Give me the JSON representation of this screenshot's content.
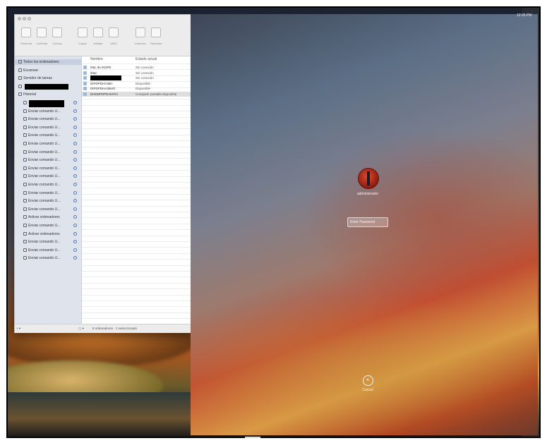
{
  "menubar": {
    "clock": "12:05 PM"
  },
  "window": {
    "toolbar": [
      {
        "label": "Observar",
        "icon": "observe-icon"
      },
      {
        "label": "Controlar",
        "icon": "control-icon"
      },
      {
        "label": "Curioso",
        "icon": "curtain-icon"
      },
      {
        "label": "Copiar",
        "icon": "copy-icon"
      },
      {
        "label": "Instalar",
        "icon": "install-icon"
      },
      {
        "label": "UNIX",
        "icon": "unix-icon"
      },
      {
        "label": "Informes",
        "icon": "reports-icon"
      },
      {
        "label": "Reinician",
        "icon": "restart-icon"
      }
    ],
    "sidebar": [
      {
        "label": "Todos los ordenadores",
        "icon": "computers-icon"
      },
      {
        "label": "Escanear",
        "icon": "scanner-icon"
      },
      {
        "label": "Servidor de tareas",
        "icon": "task-server-icon"
      },
      {
        "label": "",
        "icon": "folder-icon",
        "redacted": true
      },
      {
        "label": "Historial",
        "icon": "history-icon"
      },
      {
        "label": "",
        "icon": "item-icon",
        "redacted": true
      },
      {
        "label": "Enviar comando U...",
        "icon": "unix-command-icon"
      },
      {
        "label": "Enviar comando U...",
        "icon": "unix-command-icon"
      },
      {
        "label": "Enviar comando U...",
        "icon": "unix-command-icon"
      },
      {
        "label": "Enviar comando U...",
        "icon": "unix-command-icon"
      },
      {
        "label": "Enviar comando U...",
        "icon": "unix-command-icon"
      },
      {
        "label": "Enviar comando U...",
        "icon": "unix-command-icon"
      },
      {
        "label": "Enviar comando U...",
        "icon": "unix-command-icon"
      },
      {
        "label": "Enviar comando U...",
        "icon": "unix-command-icon"
      },
      {
        "label": "Enviar comando U...",
        "icon": "unix-command-icon"
      },
      {
        "label": "Enviar comando U...",
        "icon": "unix-command-icon"
      },
      {
        "label": "Enviar comando U...",
        "icon": "unix-command-icon"
      },
      {
        "label": "Enviar comando U...",
        "icon": "unix-command-icon"
      },
      {
        "label": "Enviar comando U...",
        "icon": "unix-command-icon"
      },
      {
        "label": "Activar ordenadores",
        "icon": "wake-icon"
      },
      {
        "label": "Enviar comando U...",
        "icon": "unix-command-icon"
      },
      {
        "label": "Activar ordenadores",
        "icon": "wake-icon"
      },
      {
        "label": "Enviar comando U...",
        "icon": "unix-command-icon"
      },
      {
        "label": "Enviar comando U...",
        "icon": "unix-command-icon"
      },
      {
        "label": "Enviar comando U...",
        "icon": "unix-command-icon"
      }
    ],
    "list_headers": {
      "name": "Nombre",
      "status": "Estado actual"
    },
    "rows": [
      {
        "name": "Mac de INSPE",
        "status": "Sin conexión"
      },
      {
        "name": "iMac",
        "status": "Sin conexión"
      },
      {
        "name": "",
        "status": "Sin conexión",
        "redacted": true
      },
      {
        "name": "DIPDPDHA35H",
        "status": "Disponible"
      },
      {
        "name": "DIPDPDHA3BHG",
        "status": "Disponible"
      },
      {
        "name": "DHDDPDPEAKPIH",
        "status": "Compartir pantalla disponible"
      }
    ],
    "status_bar": "8 ordenadores · 1 seleccionado"
  },
  "login": {
    "username": "administrador",
    "password_placeholder": "Enter Password",
    "cancel_label": "Cancel"
  }
}
